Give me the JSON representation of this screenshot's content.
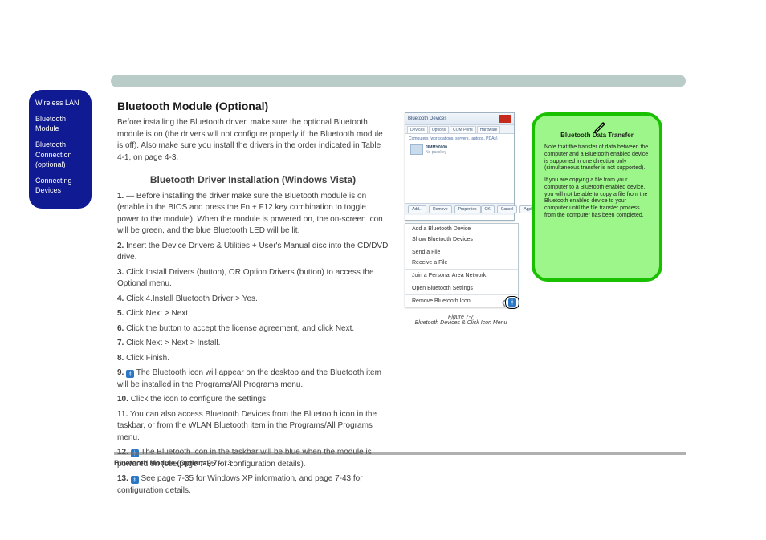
{
  "sidebar": {
    "items": [
      "Wireless LAN",
      "Bluetooth Module",
      "Bluetooth Connection (optional)",
      "Connecting Devices"
    ]
  },
  "heading": "Bluetooth Module (Optional)",
  "intro": "Before installing the Bluetooth driver, make sure the optional Bluetooth module is on (the drivers will not configure properly if the Bluetooth module is off). Also make sure you install the drivers in the order indicated in Table 4-1, on page 4-3.",
  "section_title": "Bluetooth Driver Installation (Windows Vista)",
  "steps": [
    "— Before installing the driver make sure the Bluetooth module is on (enable in the BIOS and press the Fn + F12 key combination to toggle power to the module). When the module is powered on, the on-screen icon will be green, and the blue Bluetooth LED will be lit.",
    "Insert the Device Drivers & Utilities + User's Manual disc into the CD/DVD drive.",
    "Click Install Drivers (button), OR Option Drivers (button) to access the Optional menu.",
    "Click 4.Install Bluetooth Driver > Yes.",
    "Click Next > Next.",
    "Click the button to accept the license agreement, and click Next.",
    "Click Next > Next > Install.",
    "Click Finish.",
    "The Bluetooth icon will appear on the desktop and the Bluetooth item will be installed in the Programs/All Programs menu.",
    "Click the icon to configure the settings.",
    "You can also access Bluetooth Devices from the Bluetooth icon in the taskbar, or from the WLAN Bluetooth item in the Programs/All Programs menu.",
    "The Bluetooth icon in the taskbar will be blue when the module is powered on (see page 7-35 for configuration details).",
    "See page 7-35 for Windows XP information, and page 7-43 for configuration details."
  ],
  "dialog": {
    "title": "Bluetooth Devices",
    "tabs": [
      "Devices",
      "Options",
      "COM Ports",
      "Hardware"
    ],
    "list_label": "Computers (workstations, servers, laptops, PDAs)",
    "device_name": "JIMMY0000",
    "device_sub": "No passkey",
    "buttons": {
      "add": "Add...",
      "remove": "Remove",
      "properties": "Properties",
      "ok": "OK",
      "cancel": "Cancel",
      "apply": "Apply"
    }
  },
  "context_menu": [
    "Add a Bluetooth Device",
    "Show Bluetooth Devices",
    "Send a File",
    "Receive a File",
    "Join a Personal Area Network",
    "Open Bluetooth Settings",
    "Remove Bluetooth Icon"
  ],
  "figure_caption": "Figure 7-7\nBluetooth Devices & Click Icon Menu",
  "note": {
    "title": "Bluetooth Data Transfer",
    "body1": "Note that the transfer of data between the computer and a Bluetooth enabled device is supported in one direction only (simultaneous transfer is not supported).",
    "body2": "If you are copying a file from your computer to a Bluetooth enabled device, you will not be able to copy a file from the Bluetooth enabled device to your computer until the file transfer process from the computer has been completed."
  },
  "footer": {
    "left": "Bluetooth Module (Optional)  7 - 13",
    "chapter": ""
  }
}
